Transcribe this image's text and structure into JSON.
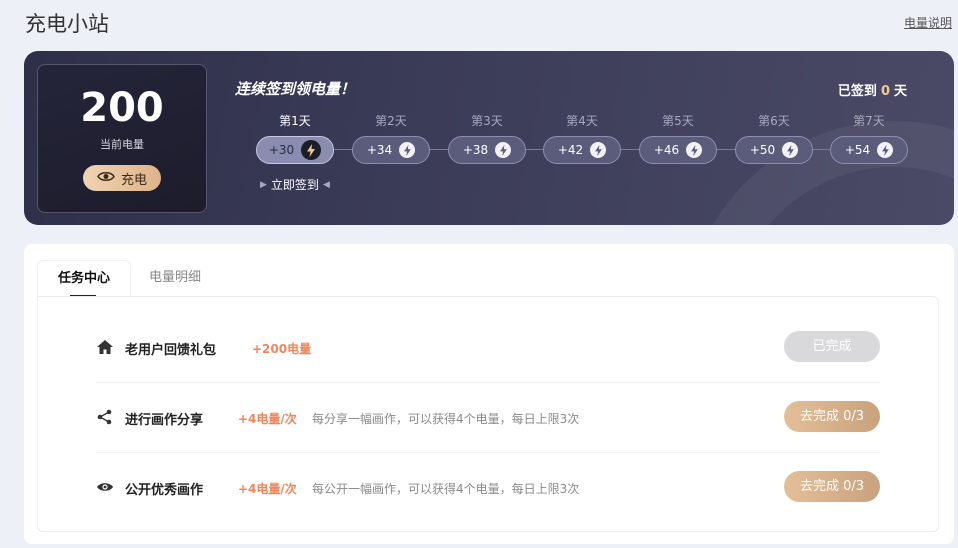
{
  "page": {
    "title": "充电小站",
    "help_link": "电量说明"
  },
  "energy": {
    "value": "200",
    "label": "当前电量",
    "charge_button": "充电"
  },
  "checkin": {
    "title": "连续签到领电量！",
    "status_prefix": "已签到",
    "status_days": "0",
    "status_suffix": "天",
    "sign_now": "立即签到",
    "days": [
      {
        "label": "第1天",
        "reward": "+30",
        "active": true
      },
      {
        "label": "第2天",
        "reward": "+34",
        "active": false
      },
      {
        "label": "第3天",
        "reward": "+38",
        "active": false
      },
      {
        "label": "第4天",
        "reward": "+42",
        "active": false
      },
      {
        "label": "第5天",
        "reward": "+46",
        "active": false
      },
      {
        "label": "第6天",
        "reward": "+50",
        "active": false
      },
      {
        "label": "第7天",
        "reward": "+54",
        "active": false
      }
    ]
  },
  "tabs": [
    {
      "label": "任务中心",
      "active": true
    },
    {
      "label": "电量明细",
      "active": false
    }
  ],
  "tasks": [
    {
      "icon": "home-icon",
      "name": "老用户回馈礼包",
      "reward": "+200电量",
      "desc": "",
      "button": "已完成",
      "completed": true
    },
    {
      "icon": "share-icon",
      "name": "进行画作分享",
      "reward": "+4电量/次",
      "desc": "每分享一幅画作，可以获得4个电量，每日上限3次",
      "button": "去完成 0/3",
      "completed": false
    },
    {
      "icon": "eye-icon",
      "name": "公开优秀画作",
      "reward": "+4电量/次",
      "desc": "每公开一幅画作，可以获得4个电量，每日上限3次",
      "button": "去完成 0/3",
      "completed": false
    }
  ],
  "colors": {
    "accent": "#f0865a",
    "gold": "#f0c893",
    "banner_bg": "#3a3b57"
  }
}
